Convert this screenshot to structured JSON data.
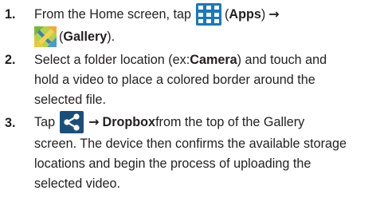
{
  "steps": [
    {
      "number": "1.",
      "lines": [
        {
          "t1": "From the Home screen, tap",
          "apps_label": "Apps",
          "arrow": "→"
        },
        {
          "gallery_label": "Gallery"
        }
      ]
    },
    {
      "number": "2.",
      "lines": [
        {
          "t1": "Select a folder location (ex: ",
          "camera_label": "Camera",
          "t2": ") and touch and"
        },
        {
          "text": "hold a video to place a colored border around the"
        },
        {
          "text": "selected file."
        }
      ]
    },
    {
      "number": "3.",
      "lines": [
        {
          "t1": "Tap",
          "arrow": "→",
          "dropbox_label": "Dropbox",
          "t2": " from the top of the Gallery"
        },
        {
          "text": "screen. The device then confirms the available storage"
        },
        {
          "text": "locations and begin the process of uploading the"
        },
        {
          "text": "selected video."
        }
      ]
    }
  ],
  "icons": {
    "apps": "apps-grid-icon",
    "gallery": "gallery-icon",
    "share": "share-icon"
  },
  "colors": {
    "text": "#231f20",
    "apps_icon": "#1a78bd",
    "share_icon": "#1b4f7a"
  }
}
